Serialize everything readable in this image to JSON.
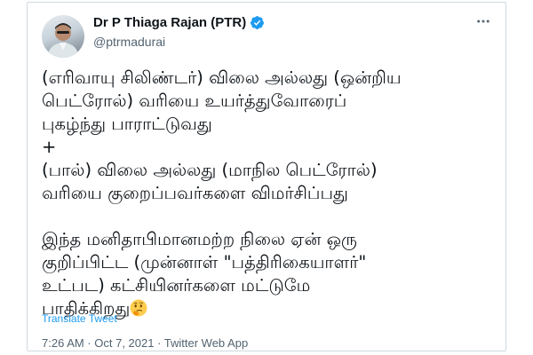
{
  "tweet": {
    "display_name": "Dr P Thiaga Rajan (PTR)",
    "handle": "@ptrmadurai",
    "more_icon": "more-horizontal-icon",
    "verified_icon": "verified-badge-icon",
    "lines": [
      "(எரிவாயு சிலிண்டர்) விலை அல்லது (ஒன்றிய",
      "பெட்ரோல்) வரியை உயர்த்துவோரைப்",
      "புகழ்ந்து பாராட்டுவது",
      "+",
      "(பால்) விலை அல்லது (மாநில பெட்ரோல்)",
      "வரியை குறைப்பவர்களை விமர்சிப்பது",
      "",
      "இந்த மனிதாபிமானமற்ற நிலை ஏன் ஒரு",
      "குறிப்பிட்ட (முன்னாள் \"பத்திரிகையாளர்\"",
      "உட்பட) கட்சியினர்களை மட்டுமே",
      "பாதிக்கிறது"
    ],
    "emoji": "thinking-face-icon",
    "translate_label": "Translate Tweet",
    "timestamp": "7:26 AM · Oct 7, 2021 · Twitter Web App",
    "colors": {
      "accent": "#1d9bf0",
      "text": "#0f1419",
      "secondary": "#536471"
    }
  }
}
